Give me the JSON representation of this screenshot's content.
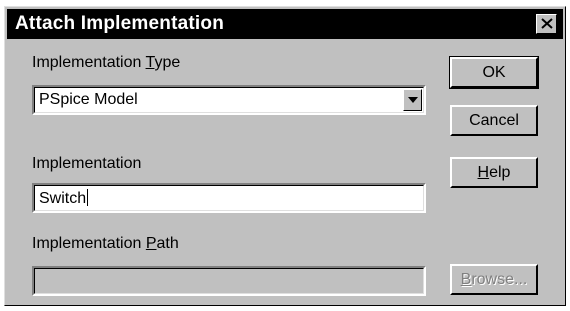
{
  "window": {
    "title": "Attach Implementation",
    "close_glyph": "×"
  },
  "implementation_type": {
    "label_prefix": "Implementation ",
    "label_accel": "T",
    "label_suffix": "ype",
    "selected_value": "PSpice Model"
  },
  "implementation": {
    "label": "Implementation",
    "value": "Switch"
  },
  "implementation_path": {
    "label_prefix": "Implementation ",
    "label_accel": "P",
    "label_suffix": "ath",
    "value": ""
  },
  "buttons": {
    "ok": "OK",
    "cancel": "Cancel",
    "help_accel": "H",
    "help_rest": "elp",
    "browse_accel": "B",
    "browse_rest": "rowse..."
  },
  "icons": {
    "close": "close-icon",
    "dropdown": "chevron-down-icon"
  },
  "colors": {
    "face": "#c0c0c0",
    "titlebar": "#000000",
    "title_text": "#ffffff",
    "disabled_text": "#808080"
  }
}
